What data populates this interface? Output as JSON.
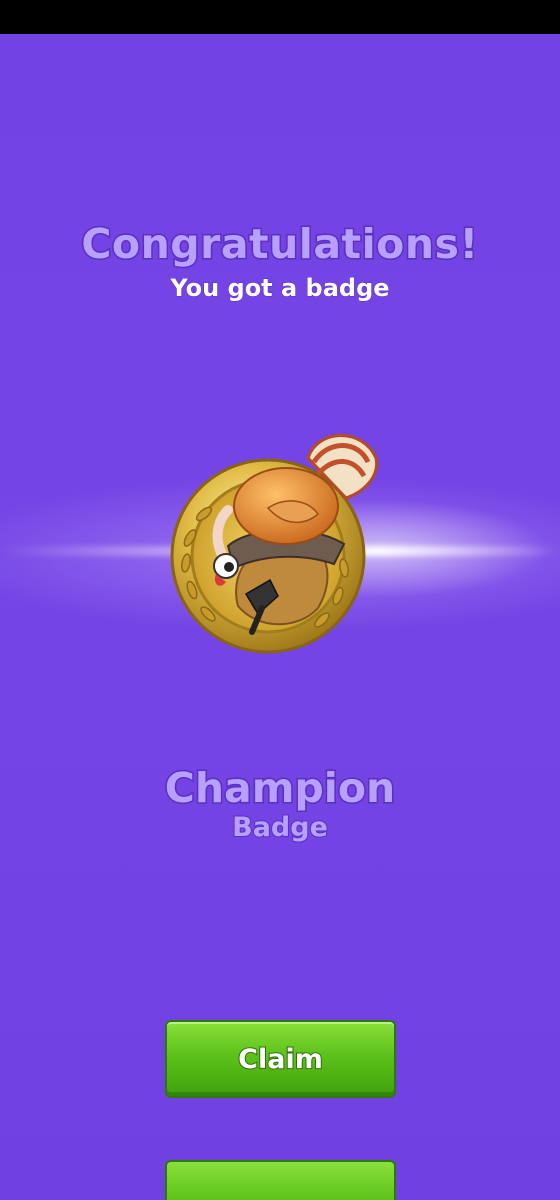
{
  "congrats": {
    "title": "Congratulations!",
    "subtitle": "You got a badge"
  },
  "badge": {
    "icon": "turkey-medal-icon",
    "name": "Champion",
    "type": "Badge"
  },
  "actions": {
    "claim_label": "Claim"
  },
  "colors": {
    "background": "#7040e0",
    "title_fill": "#b8a0ff",
    "title_outline": "#5a2fc4",
    "button_green": "#5cc21a",
    "medal_gold": "#d8b43a"
  }
}
